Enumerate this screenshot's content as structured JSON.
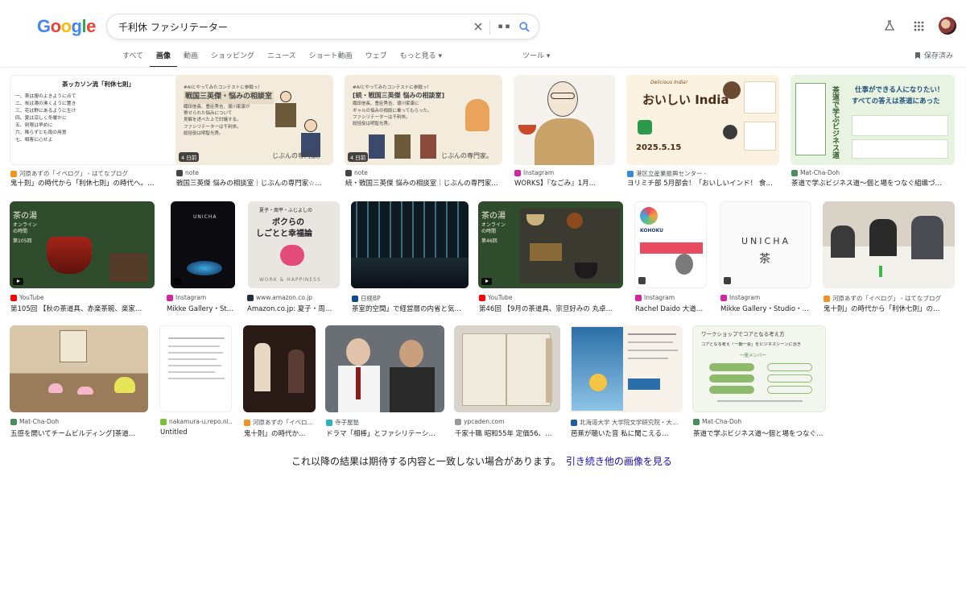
{
  "logo": "Google",
  "search": {
    "query": "千利休 ファシリテーター",
    "lens_label": "▪ ▪"
  },
  "tabs": [
    "すべて",
    "画像",
    "動画",
    "ショッピング",
    "ニュース",
    "ショート動画",
    "ウェブ",
    "もっと見る ▾"
  ],
  "tools": "ツール ▾",
  "saved": "保存済み",
  "colors": {
    "accent": "#1a0dab",
    "muted": "#5f6368"
  },
  "thumb_texts": {
    "r1_0_title": "茶ッカソン流「利休七則」",
    "r1_0_lines": [
      "一、茶は服のよきように点て",
      "二、炭は湯の沸くように置き",
      "三、花は野にあるように生け",
      "四、夏は涼しく冬暖かに",
      "五、刻限は早めに",
      "六、降らずとも雨の用意",
      "七、相客に心せよ"
    ],
    "r1_1_lines": [
      "#AIとやってみたコンテストに参戦っ！",
      "戦国三英傑・悩みの相談室",
      "織田信長、豊臣秀吉、徳川家康が",
      "寄せられた悩みについて",
      "見解を述べた上で討議する。",
      "ファシリテーターは千利休。",
      "総括役は明智光秀。"
    ],
    "r1_1_footer": "じぶんの専門家。",
    "r1_2_lines": [
      "#AIとやってみたコンテストに参戦っ！",
      "[続・戦国三英傑 悩みの相談室]",
      "織田信長、豊臣秀吉、徳川家康に",
      "ギャルの悩みの相談に乗ってもらった。",
      "ファシリテーターは千利休。",
      "総括役は明智光秀。"
    ],
    "r1_2_footer": "じぶんの専門家。",
    "r1_4_top": "Delicious India!",
    "r1_4_main": "おいしい India",
    "r1_4_date": "2025.5.15",
    "r1_5_lines": [
      "仕事ができる人になりたい！",
      "すべての答えは茶道にあった"
    ],
    "r1_5_vert": "茶道で学ぶビジネス道",
    "r2_0_lines": [
      "茶の湯",
      "オンライン",
      "の時間",
      "第105回"
    ],
    "r2_2_lines": [
      "夏子・周平・ふじよしの",
      "ボクらの",
      "しごとと幸福論"
    ],
    "r2_2_footer": "WORK & HAPPINESS",
    "r2_4_lines": [
      "茶の湯",
      "オンライン",
      "の時間",
      "第46回"
    ],
    "r2_6_word": "UNICHA",
    "r3_6_lines": [
      "ワークショップでコアとなる考え方",
      "コアとなる考え「一期一会」をビジネスシーンに活き",
      "一座メンバー"
    ]
  },
  "results": [
    {
      "source": "河原あずの「イベログ」 - はてなブログ",
      "title": "鬼十則」の時代から「利休七則」の時代へ。…",
      "badge": "",
      "favicon": "#f6921e"
    },
    {
      "source": "note",
      "title": "戦国三英傑 悩みの相談室｜じぶんの専門家☆…",
      "badge": "4 日前",
      "favicon": "#444"
    },
    {
      "source": "note",
      "title": "続・戦国三英傑 悩みの相談室｜じぶんの専門家…",
      "badge": "4 日前",
      "favicon": "#444"
    },
    {
      "source": "Instagram",
      "title": "WORKS】『なごみ』1月…",
      "badge": "",
      "favicon": "#d6249f"
    },
    {
      "source": "港区立産業振興センター -",
      "title": "ヨリミチ部 5月部会！「おいしいインド！ 食…",
      "badge": "",
      "favicon": "#3a8bd6"
    },
    {
      "source": "Mat-Cha-Doh",
      "title": "茶道で学ぶビジネス道〜個と場をつなぐ組織づ…",
      "badge": "",
      "favicon": "#4a8f5b"
    },
    {
      "source": "YouTube",
      "title": "第105回 【秋の茶道具、赤楽茶碗、楽家…",
      "badge": "",
      "favicon": "#ff0000"
    },
    {
      "source": "Instagram",
      "title": "Mikke Gallery・St…",
      "badge": "",
      "favicon": "#d6249f"
    },
    {
      "source": "www.amazon.co.jp",
      "title": "Amazon.co.jp: 夏子・周…",
      "badge": "",
      "favicon": "#232f3e"
    },
    {
      "source": "日経BP",
      "title": "茶室的空間」で経営層の内省と気…",
      "badge": "",
      "favicon": "#0a4b8f"
    },
    {
      "source": "YouTube",
      "title": "第46回 【9月の茶道具、宗旦好みの 丸卓…",
      "badge": "",
      "favicon": "#ff0000"
    },
    {
      "source": "Instagram",
      "title": "Rachel Daido 大道…",
      "badge": "",
      "favicon": "#d6249f"
    },
    {
      "source": "Instagram",
      "title": "Mikke Gallery・Studio・…",
      "badge": "",
      "favicon": "#d6249f"
    },
    {
      "source": "河原あずの「イベログ」 - はてなブログ",
      "title": "鬼十則」の時代から「利休七則」の…",
      "badge": "",
      "favicon": "#f6921e"
    },
    {
      "source": "Mat-Cha-Doh",
      "title": "五感を開いてチームビルディング]茶道…",
      "badge": "",
      "favicon": "#4a8f5b"
    },
    {
      "source": "nakamura-u.repo.ni…",
      "title": "Untitled",
      "badge": "",
      "favicon": "#7bbf3a"
    },
    {
      "source": "河原あずの「イベロ…",
      "title": "鬼十則」の時代か…",
      "badge": "",
      "favicon": "#f6921e"
    },
    {
      "source": "寺子屋塾",
      "title": "ドラマ「相棒」とファシリテーシ…",
      "badge": "",
      "favicon": "#2bb3c0"
    },
    {
      "source": "ypcaden.com",
      "title": "千家十職 昭和55年 定価56、…",
      "badge": "",
      "favicon": "#999"
    },
    {
      "source": "北海道大学 大学院文学研究院・大…",
      "title": "芭蕉が聴いた音 私に聞こえる…",
      "badge": "",
      "favicon": "#1b5e9e"
    },
    {
      "source": "Mat-Cha-Doh",
      "title": "茶道で学ぶビジネス道〜個と場をつなぐ…",
      "badge": "",
      "favicon": "#4a8f5b"
    }
  ],
  "footer": {
    "notice": "これ以降の結果は期待する内容と一致しない場合があります。",
    "link": "引き続き他の画像を見る"
  }
}
